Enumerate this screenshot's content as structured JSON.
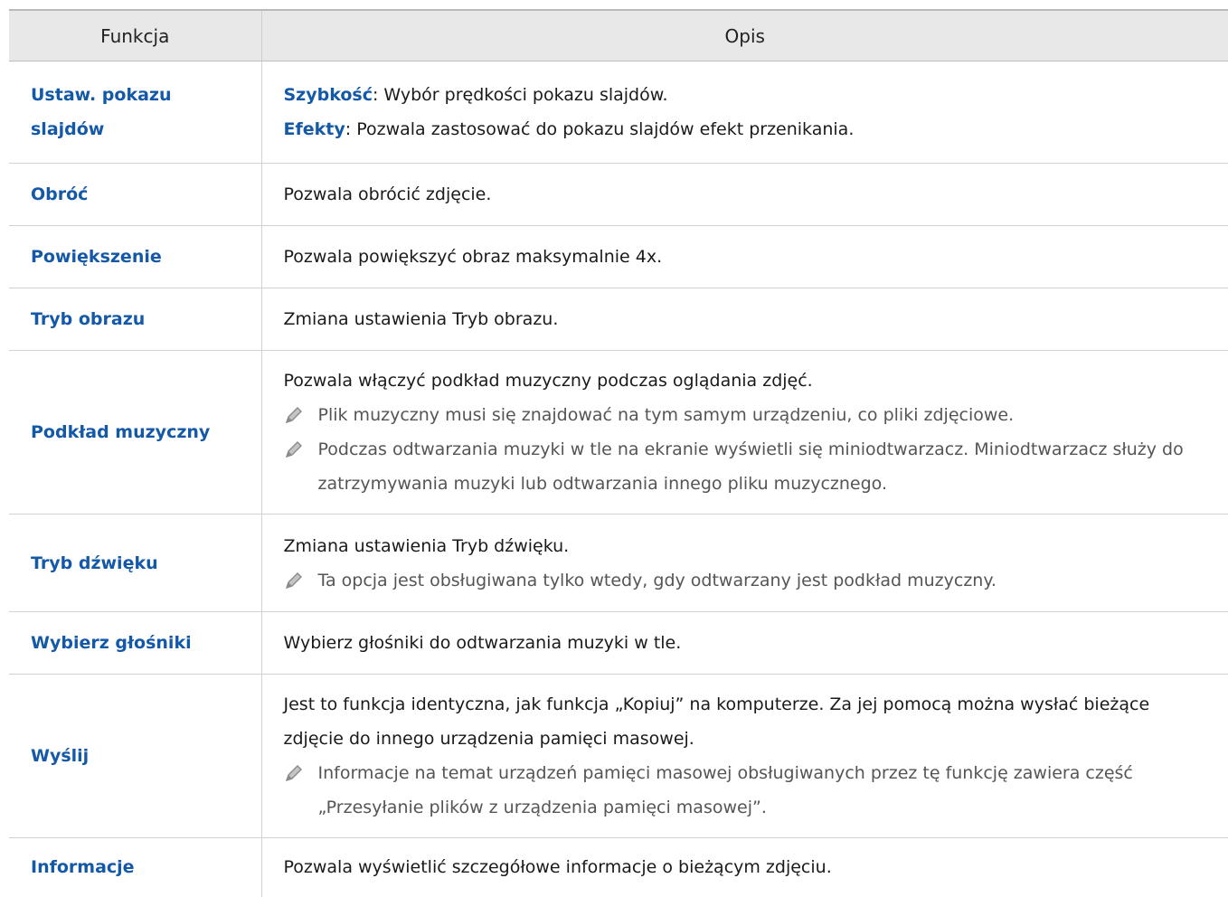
{
  "header": {
    "col1": "Funkcja",
    "col2": "Opis"
  },
  "rows": [
    {
      "name": "Ustaw. pokazu slajdów",
      "lines": [
        {
          "kw": "Szybkość",
          "text": ": Wybór prędkości pokazu slajdów."
        },
        {
          "kw": "Efekty",
          "text": ": Pozwala zastosować do pokazu slajdów efekt przenikania."
        }
      ]
    },
    {
      "name": "Obróć",
      "text": "Pozwala obrócić zdjęcie."
    },
    {
      "name": "Powiększenie",
      "text": "Pozwala powiększyć obraz maksymalnie 4x."
    },
    {
      "name": "Tryb obrazu",
      "text": "Zmiana ustawienia Tryb obrazu."
    },
    {
      "name": "Podkład muzyczny",
      "text": "Pozwala włączyć podkład muzyczny podczas oglądania zdjęć.",
      "notes": [
        "Plik muzyczny musi się znajdować na tym samym urządzeniu, co pliki zdjęciowe.",
        "Podczas odtwarzania muzyki w tle na ekranie wyświetli się miniodtwarzacz. Miniodtwarzacz służy do zatrzymywania muzyki lub odtwarzania innego pliku muzycznego."
      ]
    },
    {
      "name": "Tryb dźwięku",
      "text": "Zmiana ustawienia Tryb dźwięku.",
      "notes": [
        "Ta opcja jest obsługiwana tylko wtedy, gdy odtwarzany jest podkład muzyczny."
      ]
    },
    {
      "name": "Wybierz głośniki",
      "text": "Wybierz głośniki do odtwarzania muzyki w tle."
    },
    {
      "name": "Wyślij",
      "text": "Jest to funkcja identyczna, jak funkcja „Kopiuj” na komputerze. Za jej pomocą można wysłać bieżące zdjęcie do innego urządzenia pamięci masowej.",
      "notes": [
        "Informacje na temat urządzeń pamięci masowej obsługiwanych przez tę funkcję zawiera część „Przesyłanie plików z urządzenia pamięci masowej”."
      ]
    },
    {
      "name": "Informacje",
      "text": "Pozwala wyświetlić szczegółowe informacje o bieżącym zdjęciu."
    }
  ],
  "icons": {
    "note": "pencil-note-icon"
  },
  "colors": {
    "keyword": "#1458a8",
    "header_bg": "#e8e8e8",
    "note_text": "#555555"
  }
}
